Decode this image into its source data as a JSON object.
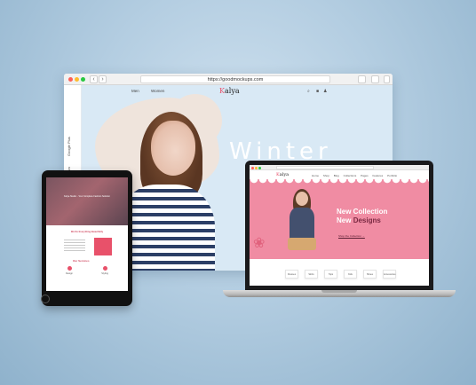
{
  "browser": {
    "url": "https://goodmockups.com",
    "nav_back": "‹",
    "nav_forward": "›",
    "side_labels": [
      "Instagram",
      "Google Plus"
    ],
    "nav_links": [
      "Men",
      "Women"
    ],
    "logo_initial": "K",
    "logo_rest": "alya",
    "header_icons": [
      "search-icon",
      "cart-icon",
      "user-icon"
    ],
    "hero_title": "Winter"
  },
  "laptop": {
    "logo_initial": "K",
    "logo_rest": "alya",
    "nav_items": [
      "Home",
      "Shop",
      "Blog",
      "Collections",
      "Pages",
      "Features",
      "Portfolio"
    ],
    "headline_line1": "New Collection",
    "headline_line2_part1": "New",
    "headline_line2_part2": "Designs",
    "shop_link": "Shop the Collection →",
    "categories": [
      "Dresses",
      "Skirts",
      "Tops",
      "Kids",
      "Shoes",
      "Accessories"
    ],
    "colors": {
      "hero": "#f08ca3",
      "accent": "#7b2a43"
    }
  },
  "tablet": {
    "hero_text": "Kalya Studio - Your Complete Fashion Solution",
    "block_title": "We Do Everything Beautifully",
    "services_title": "Our Services",
    "service_labels": [
      "Design",
      "Styling"
    ],
    "colors": {
      "accent": "#e8516a"
    }
  }
}
